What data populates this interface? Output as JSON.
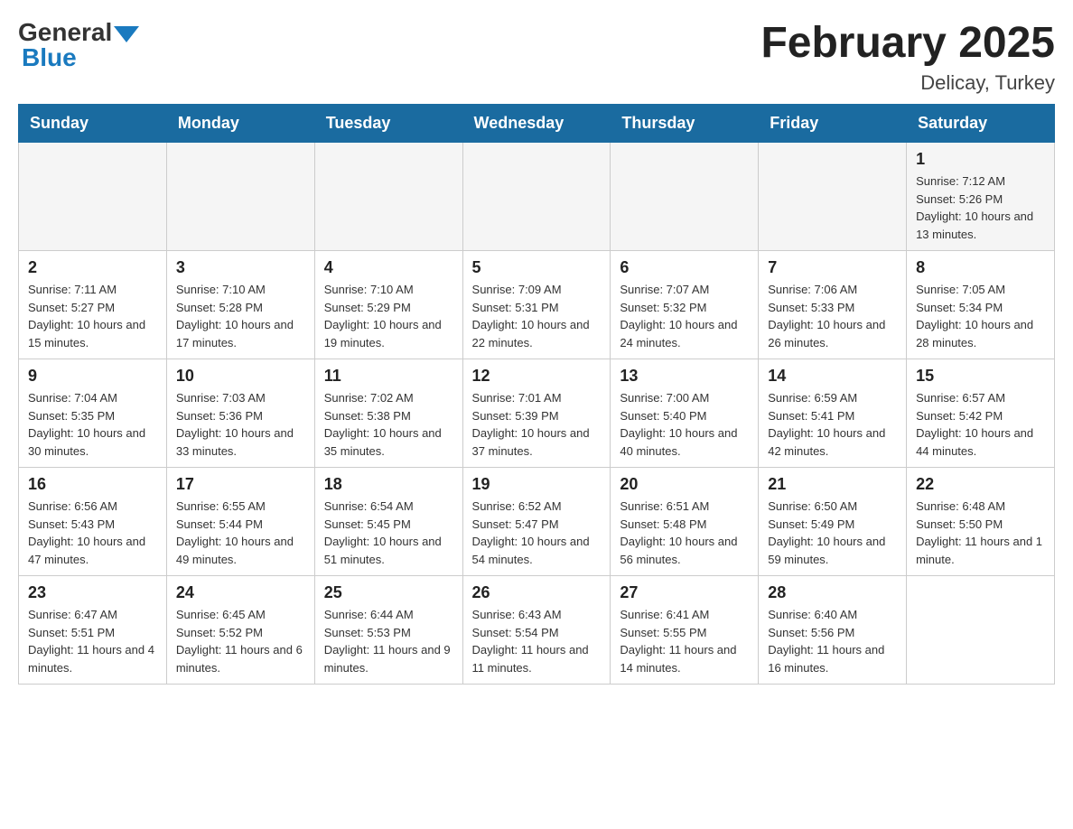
{
  "header": {
    "logo_text_general": "General",
    "logo_text_blue": "Blue",
    "title": "February 2025",
    "subtitle": "Delicay, Turkey"
  },
  "days_of_week": [
    "Sunday",
    "Monday",
    "Tuesday",
    "Wednesday",
    "Thursday",
    "Friday",
    "Saturday"
  ],
  "weeks": [
    {
      "days": [
        {
          "number": "",
          "info": ""
        },
        {
          "number": "",
          "info": ""
        },
        {
          "number": "",
          "info": ""
        },
        {
          "number": "",
          "info": ""
        },
        {
          "number": "",
          "info": ""
        },
        {
          "number": "",
          "info": ""
        },
        {
          "number": "1",
          "info": "Sunrise: 7:12 AM\nSunset: 5:26 PM\nDaylight: 10 hours and 13 minutes."
        }
      ]
    },
    {
      "days": [
        {
          "number": "2",
          "info": "Sunrise: 7:11 AM\nSunset: 5:27 PM\nDaylight: 10 hours and 15 minutes."
        },
        {
          "number": "3",
          "info": "Sunrise: 7:10 AM\nSunset: 5:28 PM\nDaylight: 10 hours and 17 minutes."
        },
        {
          "number": "4",
          "info": "Sunrise: 7:10 AM\nSunset: 5:29 PM\nDaylight: 10 hours and 19 minutes."
        },
        {
          "number": "5",
          "info": "Sunrise: 7:09 AM\nSunset: 5:31 PM\nDaylight: 10 hours and 22 minutes."
        },
        {
          "number": "6",
          "info": "Sunrise: 7:07 AM\nSunset: 5:32 PM\nDaylight: 10 hours and 24 minutes."
        },
        {
          "number": "7",
          "info": "Sunrise: 7:06 AM\nSunset: 5:33 PM\nDaylight: 10 hours and 26 minutes."
        },
        {
          "number": "8",
          "info": "Sunrise: 7:05 AM\nSunset: 5:34 PM\nDaylight: 10 hours and 28 minutes."
        }
      ]
    },
    {
      "days": [
        {
          "number": "9",
          "info": "Sunrise: 7:04 AM\nSunset: 5:35 PM\nDaylight: 10 hours and 30 minutes."
        },
        {
          "number": "10",
          "info": "Sunrise: 7:03 AM\nSunset: 5:36 PM\nDaylight: 10 hours and 33 minutes."
        },
        {
          "number": "11",
          "info": "Sunrise: 7:02 AM\nSunset: 5:38 PM\nDaylight: 10 hours and 35 minutes."
        },
        {
          "number": "12",
          "info": "Sunrise: 7:01 AM\nSunset: 5:39 PM\nDaylight: 10 hours and 37 minutes."
        },
        {
          "number": "13",
          "info": "Sunrise: 7:00 AM\nSunset: 5:40 PM\nDaylight: 10 hours and 40 minutes."
        },
        {
          "number": "14",
          "info": "Sunrise: 6:59 AM\nSunset: 5:41 PM\nDaylight: 10 hours and 42 minutes."
        },
        {
          "number": "15",
          "info": "Sunrise: 6:57 AM\nSunset: 5:42 PM\nDaylight: 10 hours and 44 minutes."
        }
      ]
    },
    {
      "days": [
        {
          "number": "16",
          "info": "Sunrise: 6:56 AM\nSunset: 5:43 PM\nDaylight: 10 hours and 47 minutes."
        },
        {
          "number": "17",
          "info": "Sunrise: 6:55 AM\nSunset: 5:44 PM\nDaylight: 10 hours and 49 minutes."
        },
        {
          "number": "18",
          "info": "Sunrise: 6:54 AM\nSunset: 5:45 PM\nDaylight: 10 hours and 51 minutes."
        },
        {
          "number": "19",
          "info": "Sunrise: 6:52 AM\nSunset: 5:47 PM\nDaylight: 10 hours and 54 minutes."
        },
        {
          "number": "20",
          "info": "Sunrise: 6:51 AM\nSunset: 5:48 PM\nDaylight: 10 hours and 56 minutes."
        },
        {
          "number": "21",
          "info": "Sunrise: 6:50 AM\nSunset: 5:49 PM\nDaylight: 10 hours and 59 minutes."
        },
        {
          "number": "22",
          "info": "Sunrise: 6:48 AM\nSunset: 5:50 PM\nDaylight: 11 hours and 1 minute."
        }
      ]
    },
    {
      "days": [
        {
          "number": "23",
          "info": "Sunrise: 6:47 AM\nSunset: 5:51 PM\nDaylight: 11 hours and 4 minutes."
        },
        {
          "number": "24",
          "info": "Sunrise: 6:45 AM\nSunset: 5:52 PM\nDaylight: 11 hours and 6 minutes."
        },
        {
          "number": "25",
          "info": "Sunrise: 6:44 AM\nSunset: 5:53 PM\nDaylight: 11 hours and 9 minutes."
        },
        {
          "number": "26",
          "info": "Sunrise: 6:43 AM\nSunset: 5:54 PM\nDaylight: 11 hours and 11 minutes."
        },
        {
          "number": "27",
          "info": "Sunrise: 6:41 AM\nSunset: 5:55 PM\nDaylight: 11 hours and 14 minutes."
        },
        {
          "number": "28",
          "info": "Sunrise: 6:40 AM\nSunset: 5:56 PM\nDaylight: 11 hours and 16 minutes."
        },
        {
          "number": "",
          "info": ""
        }
      ]
    }
  ]
}
